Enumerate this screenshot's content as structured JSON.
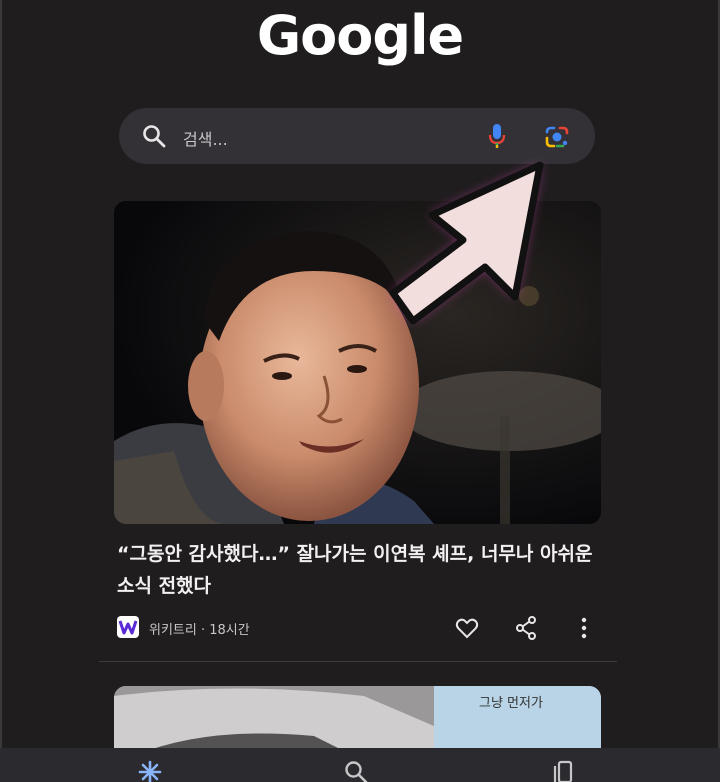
{
  "header": {
    "logo_text": "Google"
  },
  "search": {
    "placeholder": "검색...",
    "icons": [
      "search-icon",
      "mic-icon",
      "lens-icon"
    ]
  },
  "feed": {
    "cards": [
      {
        "headline": "“그동안 감사했다…” 잘나가는 이연복 셰프, 너무나 아쉬운 소식 전했다",
        "source": "위키트리",
        "time": "18시간",
        "source_line": "위키트리 · 18시간",
        "actions": [
          "like-icon",
          "share-icon",
          "more-icon"
        ]
      },
      {
        "image_text": "그냥 먼저가"
      }
    ]
  },
  "bottom_nav": {
    "items": [
      "discover-icon",
      "search-icon",
      "tabs-icon"
    ]
  },
  "colors": {
    "background": "#1f1d1e",
    "search_bar": "#333136",
    "accent_arrow_glow": "#ff4fd8",
    "arrow_fill": "#f3dede"
  }
}
